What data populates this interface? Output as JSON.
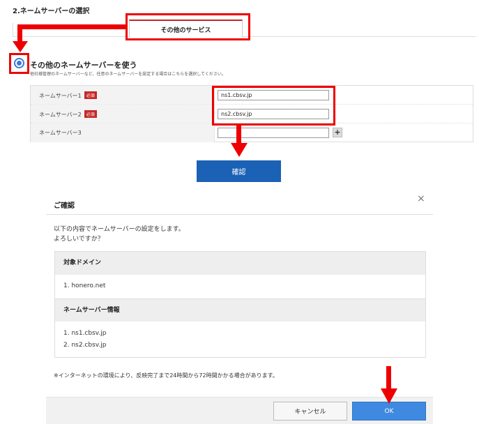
{
  "section": {
    "title": "2.ネームサーバーの選択",
    "tab_label": "その他のサービス"
  },
  "option": {
    "label": "その他のネームサーバーを使う",
    "description": "他社様管理のネームサーバーなど、任意のネームサーバーを設定する場合はこちらを選択してください。",
    "selected": true
  },
  "nameservers": [
    {
      "label": "ネームサーバー1",
      "required_badge": "必須",
      "value": "ns1.cbsv.jp"
    },
    {
      "label": "ネームサーバー2",
      "required_badge": "必須",
      "value": "ns2.cbsv.jp"
    },
    {
      "label": "ネームサーバー3",
      "value": ""
    }
  ],
  "add_icon": "plus-icon",
  "confirm_button": "確認",
  "modal": {
    "title": "ご確認",
    "close_icon": "×",
    "message_line1": "以下の内容でネームサーバーの設定をします。",
    "message_line2": "よろしいですか？",
    "domain_heading": "対象ドメイン",
    "domains": [
      "1. honero.net"
    ],
    "ns_heading": "ネームサーバー情報",
    "ns_list": [
      "1. ns1.cbsv.jp",
      "2. ns2.cbsv.jp"
    ],
    "note": "※インターネットの環境により、反映完了まで24時間から72時間かかる場合があります。",
    "cancel_label": "キャンセル",
    "ok_label": "OK"
  },
  "colors": {
    "annotation_red": "#ee0000",
    "primary_blue": "#1b61b5",
    "ok_blue": "#3f8ae0",
    "required_red": "#c62828"
  }
}
